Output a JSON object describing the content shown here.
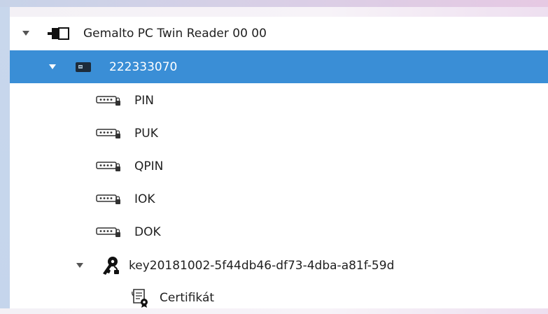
{
  "tree": {
    "reader": {
      "label": "Gemalto PC Twin Reader 00 00",
      "icon": "card-reader-icon"
    },
    "card": {
      "label": "222333070",
      "icon": "smart-card-icon"
    },
    "objects": [
      {
        "label": "PIN",
        "icon": "pin-pad-icon"
      },
      {
        "label": "PUK",
        "icon": "pin-pad-icon"
      },
      {
        "label": "QPIN",
        "icon": "pin-pad-icon"
      },
      {
        "label": "IOK",
        "icon": "pin-pad-icon"
      },
      {
        "label": "DOK",
        "icon": "pin-pad-icon"
      }
    ],
    "key": {
      "label": "key20181002-5f44db46-df73-4dba-a81f-59d",
      "icon": "key-icon"
    },
    "certificate": {
      "label": "Certifikát",
      "icon": "certificate-icon"
    }
  },
  "colors": {
    "selection": "#3a8ed6",
    "text": "#1f1f1f"
  }
}
